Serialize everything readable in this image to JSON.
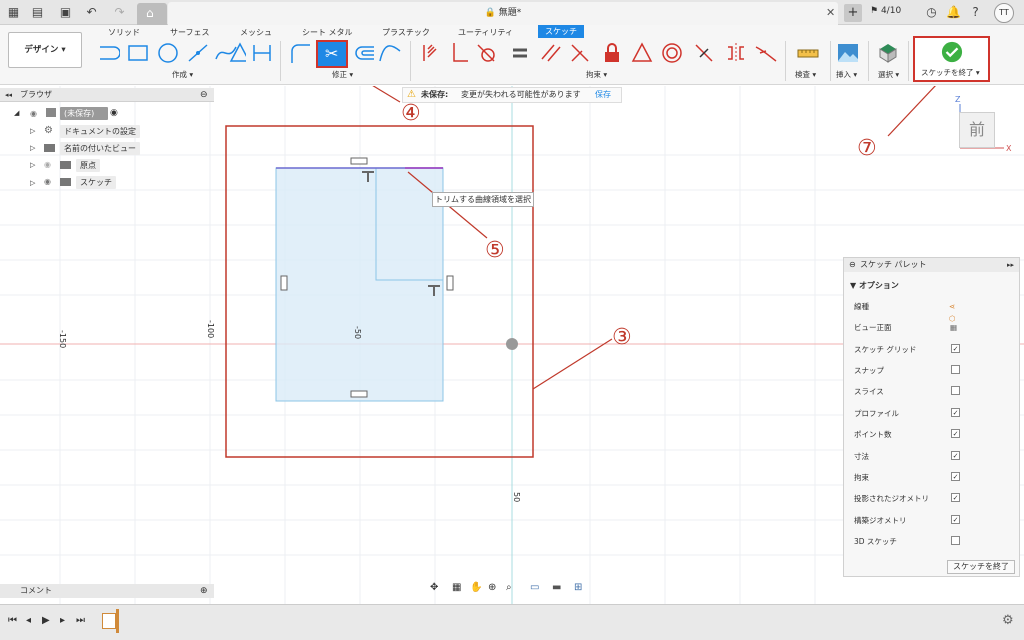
{
  "window": {
    "title": "無題*",
    "job_count": "4/10",
    "user_initials": "TT"
  },
  "toolbar": {
    "design_label": "デザイン ▾",
    "tabs": [
      "ソリッド",
      "サーフェス",
      "メッシュ",
      "シート メタル",
      "プラスチック",
      "ユーティリティ",
      "スケッチ"
    ],
    "groups": {
      "create": "作成 ▾",
      "modify": "修正 ▾",
      "constraint": "拘束 ▾",
      "inspect": "検査 ▾",
      "insert": "挿入 ▾",
      "select": "選択 ▾"
    },
    "finish_sketch_label": "スケッチを終了 ▾",
    "accent": "#1e88e5",
    "finish_color": "#3cb043"
  },
  "browser": {
    "title": "ブラウザ",
    "items": [
      "(未保存)",
      "ドキュメントの設定",
      "名前の付いたビュー",
      "原点",
      "スケッチ"
    ]
  },
  "comment": {
    "title": "コメント"
  },
  "unsaved_bar": {
    "label": "未保存:",
    "message": "変更が失われる可能性があります",
    "save": "保存"
  },
  "canvas": {
    "axis_labels": [
      "-150",
      "-100",
      "-50",
      "50"
    ],
    "tooltip": "トリムする曲線領域を選択",
    "viewcube_label": "前",
    "axis_z": "Z",
    "axis_x": "X"
  },
  "callouts": [
    "③",
    "④",
    "⑤",
    "⑦"
  ],
  "palette": {
    "title": "スケッチ パレット",
    "section": "オプション",
    "rows": [
      {
        "label": "線種",
        "type": "icon"
      },
      {
        "label": "ビュー正面",
        "type": "icon"
      },
      {
        "label": "スケッチ グリッド",
        "checked": true
      },
      {
        "label": "スナップ",
        "checked": false
      },
      {
        "label": "スライス",
        "checked": false
      },
      {
        "label": "プロファイル",
        "checked": true
      },
      {
        "label": "ポイント数",
        "checked": true
      },
      {
        "label": "寸法",
        "checked": true
      },
      {
        "label": "拘束",
        "checked": true
      },
      {
        "label": "投影されたジオメトリ",
        "checked": true
      },
      {
        "label": "構築ジオメトリ",
        "checked": true
      },
      {
        "label": "3D スケッチ",
        "checked": false
      }
    ],
    "finish_button": "スケッチを終了"
  }
}
